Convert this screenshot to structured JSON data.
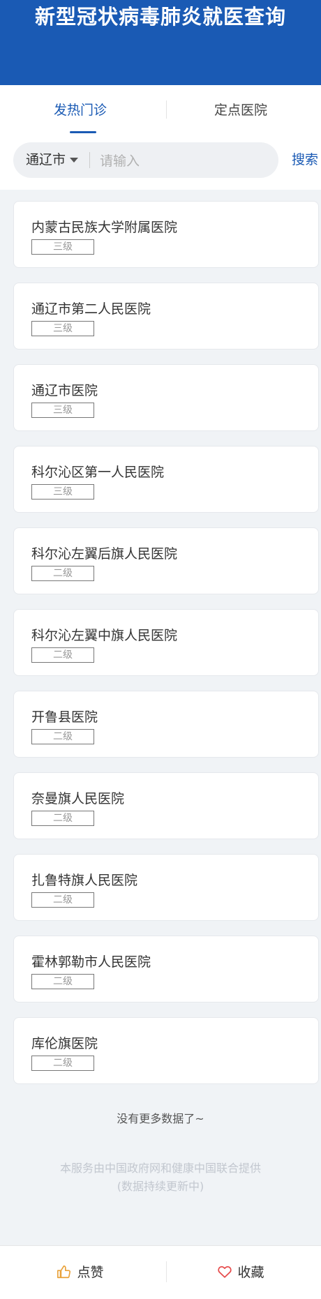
{
  "header": {
    "title": "新型冠状病毒肺炎就医查询"
  },
  "tabs": [
    {
      "label": "发热门诊"
    },
    {
      "label": "定点医院"
    }
  ],
  "search": {
    "city": "通辽市",
    "placeholder": "请输入",
    "button_label": "搜索"
  },
  "hospitals": [
    {
      "name": "内蒙古民族大学附属医院",
      "level": "三级"
    },
    {
      "name": "通辽市第二人民医院",
      "level": "三级"
    },
    {
      "name": "通辽市医院",
      "level": "三级"
    },
    {
      "name": "科尔沁区第一人民医院",
      "level": "三级"
    },
    {
      "name": "科尔沁左翼后旗人民医院",
      "level": "二级"
    },
    {
      "name": "科尔沁左翼中旗人民医院",
      "level": "二级"
    },
    {
      "name": "开鲁县医院",
      "level": "二级"
    },
    {
      "name": "奈曼旗人民医院",
      "level": "二级"
    },
    {
      "name": "扎鲁特旗人民医院",
      "level": "二级"
    },
    {
      "name": "霍林郭勒市人民医院",
      "level": "二级"
    },
    {
      "name": "库伦旗医院",
      "level": "二级"
    }
  ],
  "footer": {
    "no_more": "没有更多数据了~",
    "credit_line1": "本服务由中国政府网和健康中国联合提供",
    "credit_line2": "(数据持续更新中)"
  },
  "bottom_bar": {
    "like_label": "点赞",
    "favorite_label": "收藏"
  },
  "colors": {
    "brand": "#1a5ab4",
    "like_icon": "#e9a23b",
    "favorite_icon": "#e64b4b"
  }
}
